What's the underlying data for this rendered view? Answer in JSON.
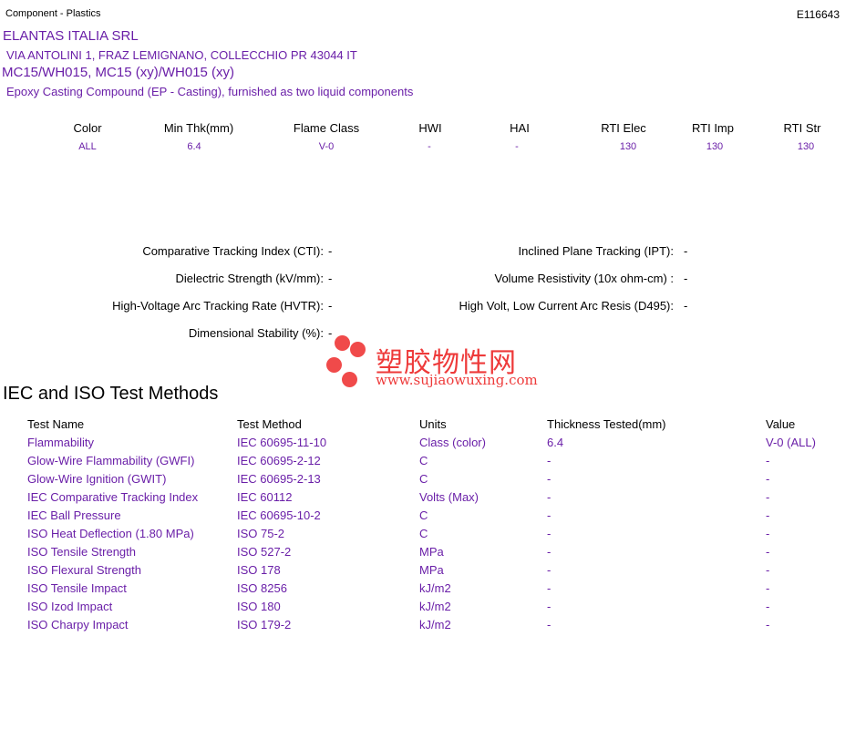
{
  "header": {
    "left": "Component - Plastics",
    "right": "E116643"
  },
  "company": {
    "name": "ELANTAS ITALIA SRL",
    "address": "VIA ANTOLINI 1, FRAZ LEMIGNANO, COLLECCHIO  PR  43044 IT"
  },
  "product": {
    "name": "MC15/WH015, MC15 (xy)/WH015 (xy)",
    "description": "Epoxy Casting Compound (EP - Casting), furnished as two liquid components"
  },
  "summary": {
    "headers": [
      "Color",
      "Min Thk(mm)",
      "Flame Class",
      "HWI",
      "HAI",
      "RTI Elec",
      "RTI Imp",
      "RTI Str"
    ],
    "values": [
      "ALL",
      "6.4",
      "V-0",
      "-",
      "-",
      "130",
      "130",
      "130"
    ]
  },
  "properties": {
    "left": [
      {
        "label": "Comparative Tracking Index (CTI):",
        "value": "-"
      },
      {
        "label": "Dielectric Strength (kV/mm):",
        "value": "-"
      },
      {
        "label": "High-Voltage Arc Tracking Rate (HVTR):",
        "value": "-"
      },
      {
        "label": "Dimensional Stability (%):",
        "value": "-"
      }
    ],
    "right": [
      {
        "label": "Inclined Plane Tracking (IPT):",
        "value": "-"
      },
      {
        "label": "Volume Resistivity (10x ohm-cm) :",
        "value": "-"
      },
      {
        "label": "High Volt, Low Current Arc Resis (D495):",
        "value": "-"
      }
    ]
  },
  "watermark": {
    "cn": "塑胶物性网",
    "url": "www.sujiaowuxing.com"
  },
  "iec": {
    "title": "IEC and ISO Test Methods",
    "headers": [
      "Test Name",
      "Test Method",
      "Units",
      "Thickness Tested(mm)",
      "Value"
    ],
    "rows": [
      [
        "Flammability",
        "IEC 60695-11-10",
        "Class (color)",
        "6.4",
        "V-0 (ALL)"
      ],
      [
        "Glow-Wire Flammability (GWFI)",
        "IEC 60695-2-12",
        "C",
        "-",
        "-"
      ],
      [
        "Glow-Wire Ignition (GWIT)",
        "IEC 60695-2-13",
        "C",
        "-",
        "-"
      ],
      [
        "IEC Comparative Tracking Index",
        "IEC 60112",
        "Volts (Max)",
        "-",
        "-"
      ],
      [
        "IEC Ball Pressure",
        "IEC 60695-10-2",
        "C",
        "-",
        "-"
      ],
      [
        "ISO Heat Deflection (1.80 MPa)",
        "ISO 75-2",
        "C",
        "-",
        "-"
      ],
      [
        "ISO Tensile Strength",
        "ISO 527-2",
        "MPa",
        "-",
        "-"
      ],
      [
        "ISO Flexural Strength",
        "ISO 178",
        "MPa",
        "-",
        "-"
      ],
      [
        "ISO Tensile Impact",
        "ISO 8256",
        "kJ/m2",
        "-",
        "-"
      ],
      [
        "ISO Izod Impact",
        "ISO 180",
        "kJ/m2",
        "-",
        "-"
      ],
      [
        "ISO Charpy Impact",
        "ISO 179-2",
        "kJ/m2",
        "-",
        "-"
      ]
    ]
  }
}
